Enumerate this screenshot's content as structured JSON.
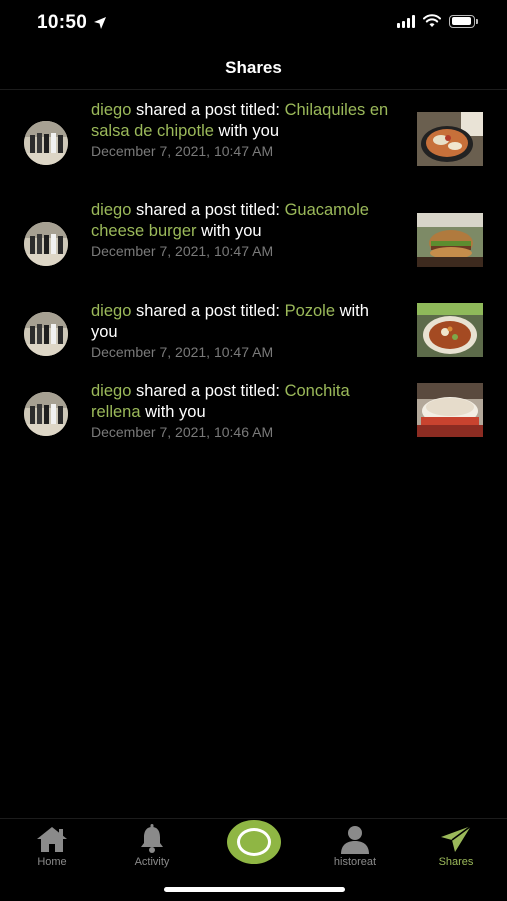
{
  "status_bar": {
    "time": "10:50"
  },
  "header": {
    "title": "Shares"
  },
  "shares": [
    {
      "user": "diego",
      "action": " shared a post titled: ",
      "post": "Chilaquiles en salsa de chipotle",
      "suffix": " with you",
      "date": "December 7, 2021, 10:47 AM"
    },
    {
      "user": "diego",
      "action": " shared a post titled: ",
      "post": "Guacamole cheese burger",
      "suffix": " with you",
      "date": "December 7, 2021, 10:47 AM"
    },
    {
      "user": "diego",
      "action": " shared a post titled: ",
      "post": "Pozole",
      "suffix": " with you",
      "date": "December 7, 2021, 10:47 AM"
    },
    {
      "user": "diego",
      "action": " shared a post titled: ",
      "post": "Conchita rellena",
      "suffix": " with you",
      "date": "December 7, 2021, 10:46 AM"
    }
  ],
  "tabs": {
    "home": "Home",
    "activity": "Activity",
    "profile": "historeat",
    "shares": "Shares"
  },
  "colors": {
    "accent": "#9bb95a",
    "background": "#000000",
    "muted": "#7a7a7a"
  }
}
